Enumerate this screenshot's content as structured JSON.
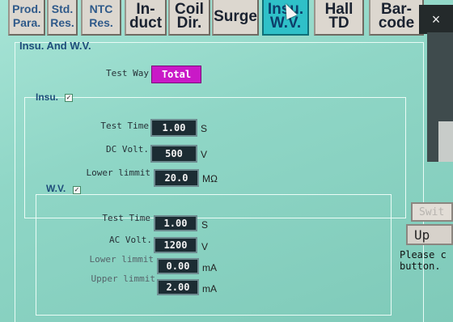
{
  "tabs": [
    {
      "label": "Prod.\nPara."
    },
    {
      "label": "Std.\nRes."
    },
    {
      "label": "NTC\nRes."
    },
    {
      "label": "In-\nduct"
    },
    {
      "label": "Coil\nDir."
    },
    {
      "label": "Surge"
    },
    {
      "label": "Insu.\nW.V."
    },
    {
      "label": "Hall\nTD"
    },
    {
      "label": "Bar-\ncode"
    }
  ],
  "close_label": "×",
  "panel": {
    "title": "Insu. And W.V.",
    "test_way": {
      "label": "Test Way",
      "value": "Total"
    }
  },
  "insu": {
    "title": "Insu.",
    "test_time": {
      "label": "Test Time",
      "value": "1.00",
      "unit": "S"
    },
    "dc_volt": {
      "label": "DC Volt.",
      "value": "500",
      "unit": "V"
    },
    "lower_limit": {
      "label": "Lower limmit",
      "value": "20.0",
      "unit": "MΩ"
    }
  },
  "wv": {
    "title": "W.V.",
    "test_time": {
      "label": "Test Time",
      "value": "1.00",
      "unit": "S"
    },
    "ac_volt": {
      "label": "AC Volt.",
      "value": "1200",
      "unit": "V"
    },
    "lower_limit": {
      "label": "Lower limmit",
      "value": "0.00",
      "unit": "mA"
    },
    "upper_limit": {
      "label": "Upper limmit",
      "value": "2.00",
      "unit": "mA"
    }
  },
  "side": {
    "switch_label": "Swit",
    "up_label": "Up",
    "message": "Please c\nbutton."
  }
}
